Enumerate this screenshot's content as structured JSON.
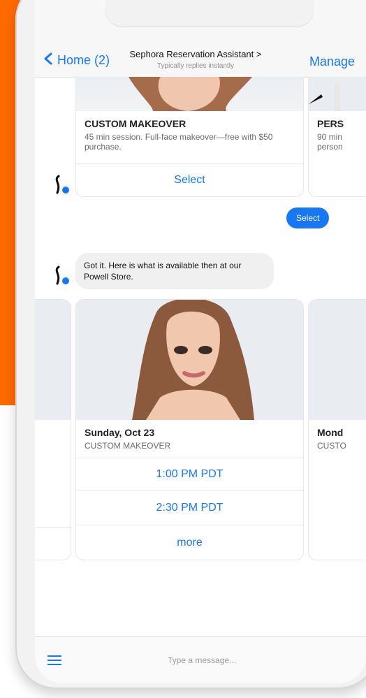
{
  "header": {
    "back_label": "Home (2)",
    "chat_title": "Sephora Reservation Assistant >",
    "subtitle": "Typically replies instantly",
    "manage_label": "Manage"
  },
  "services": [
    {
      "title": "CUSTOM MAKEOVER",
      "desc": "45 min session. Full-face makeover—free with $50 purchase.",
      "button": "Select"
    },
    {
      "title": "PERS",
      "desc": "90 min\nperson",
      "button": ""
    }
  ],
  "user_reply": "Select",
  "assistant_message": "Got it. Here is what is available then at our Powell Store.",
  "availability": [
    {
      "day": "Sunday, Oct 23",
      "type": "CUSTOM MAKEOVER",
      "times": [
        "1:00 PM PDT",
        "2:30 PM PDT"
      ],
      "more": "more"
    },
    {
      "day": "Mond",
      "type": "CUSTO"
    }
  ],
  "composer": {
    "placeholder": "Type a message..."
  },
  "colors": {
    "accent": "#1877f2",
    "orange": "#ff6a00"
  }
}
